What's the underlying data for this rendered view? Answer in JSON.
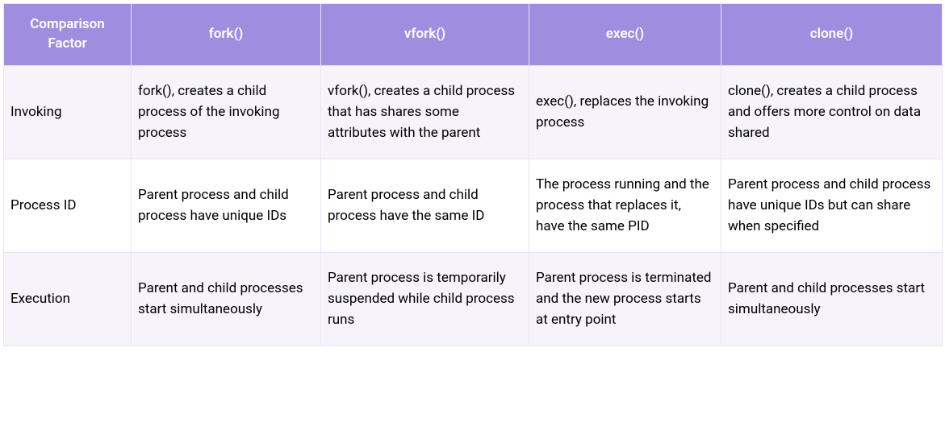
{
  "table": {
    "headers": [
      "Comparison Factor",
      "fork()",
      "vfork()",
      "exec()",
      "clone()"
    ],
    "rows": [
      {
        "factor": "Invoking",
        "fork": "fork(), creates a child process of the invoking process",
        "vfork": "vfork(), creates a child process that has shares some attributes with the parent",
        "exec": "exec(), replaces the invoking process",
        "clone": "clone(), creates a child process and offers more control on data shared"
      },
      {
        "factor": "Process ID",
        "fork": "Parent process and child process have unique IDs",
        "vfork": "Parent process and child process have the same ID",
        "exec": "The process running and the process that replaces it, have the same PID",
        "clone": "Parent process and child process have unique IDs but can share when specified"
      },
      {
        "factor": "Execution",
        "fork": "Parent and child processes start simultaneously",
        "vfork": "Parent process is temporarily suspended while child process runs",
        "exec": "Parent process is terminated and the new process starts at entry point",
        "clone": "Parent and child processes start simultaneously"
      }
    ]
  }
}
